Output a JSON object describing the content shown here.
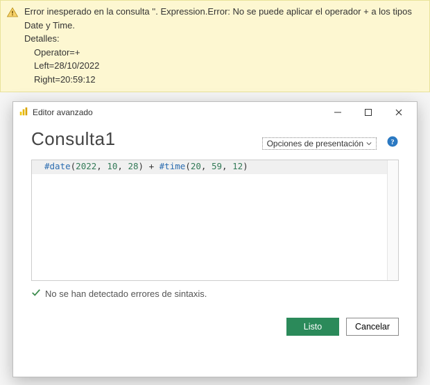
{
  "warning": {
    "message": "Error inesperado en la consulta ''. Expression.Error: No se puede aplicar el operador + a los tipos Date y Time.",
    "details_label": "Detalles:",
    "operator_line": "Operator=+",
    "left_line": "Left=28/10/2022",
    "right_line": "Right=20:59:12"
  },
  "dialog": {
    "title": "Editor avanzado",
    "query_name": "Consulta1",
    "display_options": "Opciones de presentación",
    "status": "No se han detectado errores de sintaxis.",
    "done": "Listo",
    "cancel": "Cancelar"
  },
  "code": {
    "fn1": "#date",
    "open1": "(",
    "y": "2022",
    "c1": ", ",
    "m": "10",
    "c2": ", ",
    "d": "28",
    "close1": ")",
    "plus": " + ",
    "fn2": "#time",
    "open2": "(",
    "hh": "20",
    "c3": ", ",
    "mm": "59",
    "c4": ", ",
    "ss": "12",
    "close2": ")"
  }
}
